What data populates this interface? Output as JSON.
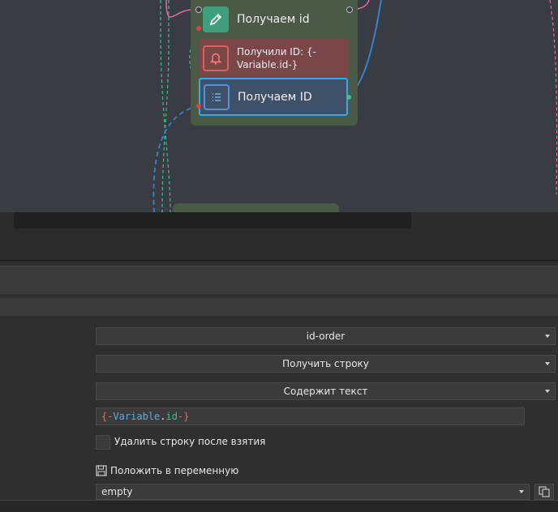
{
  "canvas": {
    "nodes": [
      {
        "label": "Получаем id",
        "icon": "pencil-icon",
        "color": "#3f9e7c"
      },
      {
        "label": "Получили ID: {-Variable.id-}",
        "icon": "bell-icon",
        "color": "#7a4648"
      },
      {
        "label": "Получаем ID",
        "icon": "list-icon",
        "color": "#3e5169",
        "selected": true
      }
    ]
  },
  "props": {
    "source_select": "id-order",
    "action_select": "Получить строку",
    "mode_select": "Содержит текст",
    "text_input": {
      "open": "{-",
      "var": "Variable",
      "dot": ".",
      "field": "id",
      "close": "-}"
    },
    "delete_checkbox_label": "Удалить строку после взятия",
    "delete_checkbox_checked": false,
    "save_label": "Положить в переменную",
    "variable_select": "empty"
  },
  "colors": {
    "accent": "#3aa7e6",
    "link_pink": "#e06aa0",
    "link_blue": "#3a7fd0",
    "link_green": "#3fbf8a"
  }
}
